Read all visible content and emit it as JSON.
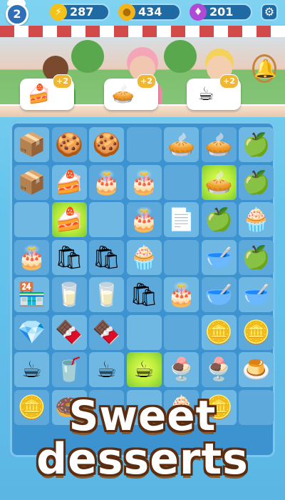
{
  "hud": {
    "level": "2",
    "energy": "287",
    "coins": "434",
    "gems": "201",
    "icons": {
      "energy": "lightning-icon",
      "coins": "coin-icon",
      "gems": "gem-icon",
      "settings": "gear-icon"
    }
  },
  "orders": [
    {
      "item": "strawberry-cake-icon",
      "reward": "+2"
    },
    {
      "item": "apple-pie-icon",
      "reward": "+2"
    },
    {
      "item": "hot-chocolate-icon",
      "reward": "+2"
    }
  ],
  "bell_icon": "bell-icon",
  "headline": {
    "line1": "Sweet",
    "line2": "desserts"
  },
  "colors": {
    "board": "#3d93cf",
    "cell": "#6fb8e4",
    "glow": "#b6ea3a",
    "headline_outline": "#5a2d11"
  }
}
